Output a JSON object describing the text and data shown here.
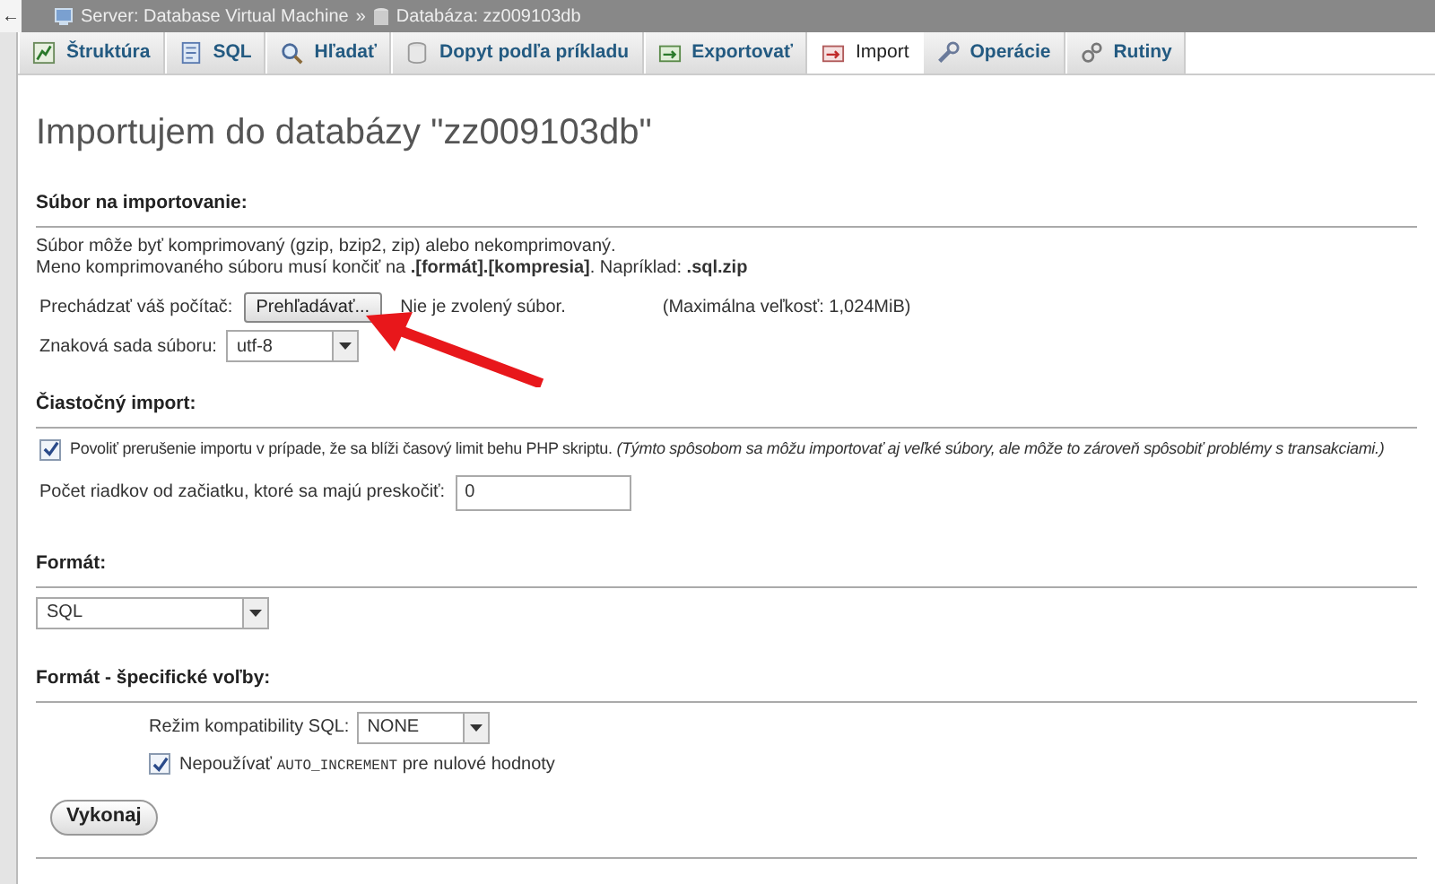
{
  "breadcrumb": {
    "back": "←",
    "server": "Server: Database Virtual Machine",
    "separator": "»",
    "database": "Databáza: zz009103db"
  },
  "tabs": [
    {
      "label": "Štruktúra",
      "selected": false
    },
    {
      "label": "SQL",
      "selected": false
    },
    {
      "label": "Hľadať",
      "selected": false
    },
    {
      "label": "Dopyt podľa príkladu",
      "selected": false
    },
    {
      "label": "Exportovať",
      "selected": false
    },
    {
      "label": "Import",
      "selected": true
    },
    {
      "label": "Operácie",
      "selected": false
    },
    {
      "label": "Rutiny",
      "selected": false
    }
  ],
  "title": "Importujem do databázy \"zz009103db\"",
  "file_section": {
    "heading": "Súbor na importovanie:",
    "note_1": "Súbor môže byť komprimovaný (gzip, bzip2, zip) alebo nekomprimovaný.",
    "note_2": "Meno komprimovaného súboru musí končiť na **.[formát].[kompresia]**. Napríklad: **.sql.zip**",
    "browse_label": "Prechádzať váš počítač:",
    "browse_button": "Prehľadávať...",
    "no_file": "Nie je zvolený súbor.",
    "max_size": "(Maximálna veľkosť: 1,024MiB)",
    "charset_label": "Znaková sada súboru:",
    "charset_value": "utf-8"
  },
  "partial_section": {
    "heading": "Čiastočný import:",
    "allow_interrupt": {
      "checked": true,
      "label": "Povoliť prerušenie importu v prípade, že sa blíži časový limit behu PHP skriptu.",
      "hint": "(Týmto spôsobom sa môžu importovať aj veľké súbory, ale môže to zároveň spôsobiť problémy s transakciami.)"
    },
    "skip_label": "Počet riadkov od začiatku, ktoré sa majú preskočiť:",
    "skip_value": "0"
  },
  "format_section": {
    "heading": "Formát:",
    "value": "SQL"
  },
  "options_section": {
    "heading": "Formát - špecifické voľby:",
    "compat_label": "Režim kompatibility SQL:",
    "compat_value": "NONE",
    "no_auto_increment": {
      "checked": true,
      "before": "Nepoužívať",
      "code": "AUTO_INCREMENT",
      "after": "pre nulové hodnoty"
    }
  },
  "submit": "Vykonaj"
}
